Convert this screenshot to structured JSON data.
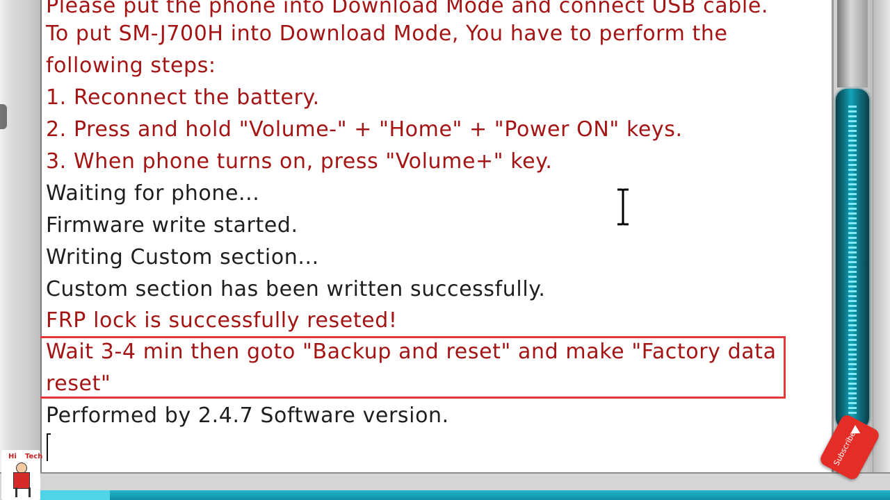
{
  "log": {
    "lines": [
      {
        "text": "Please put the phone into Download Mode and connect USB cable.",
        "color": "red"
      },
      {
        "text": "To put SM-J700H into Download Mode, You have to perform the",
        "color": "red"
      },
      {
        "text": " following steps:",
        "color": "red"
      },
      {
        "text": "1. Reconnect the battery.",
        "color": "red"
      },
      {
        "text": "2. Press and hold \"Volume-\" + \"Home\" + \"Power ON\" keys.",
        "color": "red"
      },
      {
        "text": "3. When phone turns on, press \"Volume+\" key.",
        "color": "red"
      },
      {
        "text": "Waiting for phone...",
        "color": "dark"
      },
      {
        "text": "Firmware write started.",
        "color": "dark"
      },
      {
        "text": "Writing Custom section...",
        "color": "dark"
      },
      {
        "text": "Custom section has been written successfully.",
        "color": "dark"
      },
      {
        "text": "FRP lock is successfully reseted!",
        "color": "red"
      }
    ],
    "highlighted_message": "Wait 3-4 min then goto \"Backup and reset\" and make \"Factory data reset\"",
    "final_line": "Performed by 2.4.7 Software version."
  },
  "colors": {
    "red_text": "#a51414",
    "dark_text": "#1e1e1e",
    "highlight_border": "#e23a3a",
    "scroll_thumb": "#13a4b8"
  },
  "overlay": {
    "subscribe_label": "Subscribe",
    "logo_hi": "Hi",
    "logo_tech": "Tech"
  },
  "icons": {
    "cursor": "i-beam-cursor-icon",
    "play": "play-icon"
  }
}
